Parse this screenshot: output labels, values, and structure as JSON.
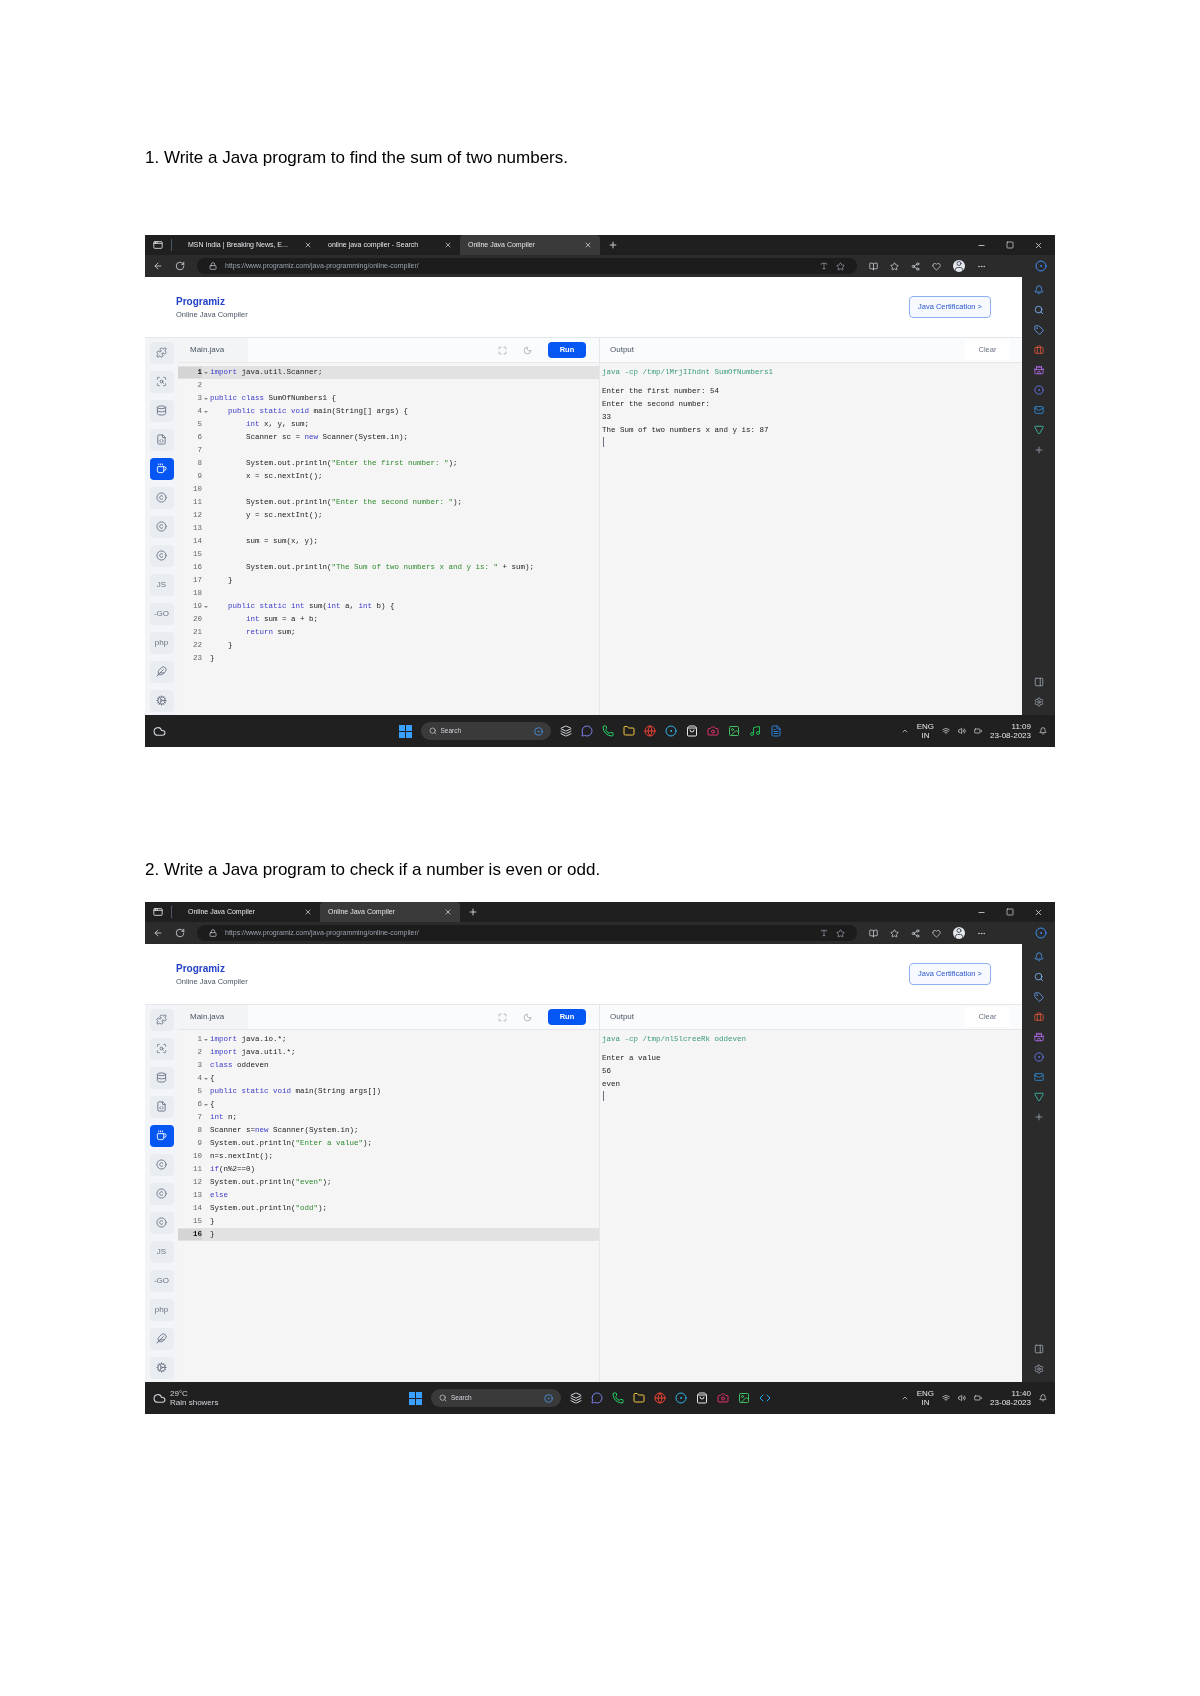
{
  "questions": [
    {
      "heading": "1. Write a Java program to find the sum of two numbers.",
      "screenshot": {
        "browser_tabs": [
          {
            "title": "MSN India | Breaking News, E...",
            "selected": false
          },
          {
            "title": "online java compiler - Search",
            "selected": false
          },
          {
            "title": "Online Java Compiler",
            "selected": true
          }
        ],
        "address": "https://www.programiz.com/java-programming/online-compiler/",
        "header": {
          "logo": "Programiz",
          "subtitle": "Online Java Compiler",
          "cta": "Java Certification >"
        },
        "language_rail": [
          {
            "kind": "icon",
            "selected": false
          },
          {
            "kind": "icon",
            "selected": false
          },
          {
            "kind": "icon",
            "selected": false
          },
          {
            "kind": "icon",
            "selected": false
          },
          {
            "kind": "icon",
            "selected": true
          },
          {
            "kind": "icon",
            "selected": false
          },
          {
            "kind": "icon",
            "selected": false
          },
          {
            "kind": "icon",
            "selected": false
          },
          {
            "kind": "text",
            "label": "JS",
            "selected": false
          },
          {
            "kind": "text",
            "label": "-GO",
            "selected": false
          },
          {
            "kind": "text",
            "label": "php",
            "selected": false
          },
          {
            "kind": "icon",
            "selected": false
          },
          {
            "kind": "icon",
            "selected": false
          }
        ],
        "editor": {
          "file_tab": "Main.java",
          "run": "Run",
          "lines": [
            {
              "num": "1",
              "fold": true,
              "selected": true,
              "segments": [
                {
                  "kind": "keyword",
                  "text": "import"
                },
                {
                  "kind": "plain",
                  "text": " java.util.Scanner;"
                }
              ]
            },
            {
              "num": "2",
              "fold": false,
              "selected": false
            },
            {
              "num": "3",
              "fold": true,
              "selected": false,
              "segments": [
                {
                  "kind": "keyword",
                  "text": "public class"
                },
                {
                  "kind": "plain",
                  "text": " SumOfNumbers1 {"
                }
              ]
            },
            {
              "num": "4",
              "fold": true,
              "selected": false,
              "segments": [
                {
                  "kind": "keyword",
                  "text": "    public static void"
                },
                {
                  "kind": "plain",
                  "text": " main(String[] args) {"
                }
              ]
            },
            {
              "num": "5",
              "fold": false,
              "selected": false,
              "segments": [
                {
                  "kind": "keyword",
                  "text": "        int"
                },
                {
                  "kind": "plain",
                  "text": " x, y, sum;"
                }
              ]
            },
            {
              "num": "6",
              "fold": false,
              "selected": false,
              "segments": [
                {
                  "kind": "plain",
                  "text": "        Scanner sc = "
                },
                {
                  "kind": "keyword",
                  "text": "new"
                },
                {
                  "kind": "plain",
                  "text": " Scanner(System.in);"
                }
              ]
            },
            {
              "num": "7",
              "fold": false,
              "selected": false
            },
            {
              "num": "8",
              "fold": false,
              "selected": false,
              "segments": [
                {
                  "kind": "plain",
                  "text": "        System.out.println("
                },
                {
                  "kind": "string",
                  "text": "\"Enter the first number: \""
                },
                {
                  "kind": "plain",
                  "text": ");"
                }
              ]
            },
            {
              "num": "9",
              "fold": false,
              "selected": false,
              "segments": [
                {
                  "kind": "plain",
                  "text": "        x = sc.nextInt();"
                }
              ]
            },
            {
              "num": "10",
              "fold": false,
              "selected": false
            },
            {
              "num": "11",
              "fold": false,
              "selected": false,
              "segments": [
                {
                  "kind": "plain",
                  "text": "        System.out.println("
                },
                {
                  "kind": "string",
                  "text": "\"Enter the second number: \""
                },
                {
                  "kind": "plain",
                  "text": ");"
                }
              ]
            },
            {
              "num": "12",
              "fold": false,
              "selected": false,
              "segments": [
                {
                  "kind": "plain",
                  "text": "        y = sc.nextInt();"
                }
              ]
            },
            {
              "num": "13",
              "fold": false,
              "selected": false
            },
            {
              "num": "14",
              "fold": false,
              "selected": false,
              "segments": [
                {
                  "kind": "plain",
                  "text": "        sum = sum(x, y);"
                }
              ]
            },
            {
              "num": "15",
              "fold": false,
              "selected": false
            },
            {
              "num": "16",
              "fold": false,
              "selected": false,
              "segments": [
                {
                  "kind": "plain",
                  "text": "        System.out.println("
                },
                {
                  "kind": "string",
                  "text": "\"The Sum of two numbers x and y is: \""
                },
                {
                  "kind": "plain",
                  "text": " + sum);"
                }
              ]
            },
            {
              "num": "17",
              "fold": false,
              "selected": false,
              "segments": [
                {
                  "kind": "plain",
                  "text": "    }"
                }
              ]
            },
            {
              "num": "18",
              "fold": false,
              "selected": false
            },
            {
              "num": "19",
              "fold": true,
              "selected": false,
              "segments": [
                {
                  "kind": "keyword",
                  "text": "    public static int"
                },
                {
                  "kind": "plain",
                  "text": " sum("
                },
                {
                  "kind": "keyword",
                  "text": "int"
                },
                {
                  "kind": "plain",
                  "text": " a, "
                },
                {
                  "kind": "keyword",
                  "text": "int"
                },
                {
                  "kind": "plain",
                  "text": " b) {"
                }
              ]
            },
            {
              "num": "20",
              "fold": false,
              "selected": false,
              "segments": [
                {
                  "kind": "keyword",
                  "text": "        int"
                },
                {
                  "kind": "plain",
                  "text": " sum = a + b;"
                }
              ]
            },
            {
              "num": "21",
              "fold": false,
              "selected": false,
              "segments": [
                {
                  "kind": "keyword",
                  "text": "        return"
                },
                {
                  "kind": "plain",
                  "text": " sum;"
                }
              ]
            },
            {
              "num": "22",
              "fold": false,
              "selected": false,
              "segments": [
                {
                  "kind": "plain",
                  "text": "    }"
                }
              ]
            },
            {
              "num": "23",
              "fold": false,
              "selected": false,
              "segments": [
                {
                  "kind": "plain",
                  "text": "}"
                }
              ]
            }
          ]
        },
        "output": {
          "title": "Output",
          "clear": "Clear",
          "lines": [
            {
              "kind": "command",
              "text": "java -cp /tmp/lMrjIIhdnt SumOfNumbers1"
            },
            {
              "kind": "text",
              "text": "Enter the first number: 54"
            },
            {
              "kind": "text",
              "text": "Enter the second number: "
            },
            {
              "kind": "text",
              "text": "33"
            },
            {
              "kind": "text",
              "text": "The Sum of two numbers x and y is: 87"
            }
          ]
        },
        "taskbar": {
          "search": "Search",
          "apps": [
            {
              "kind": "taskview"
            },
            {
              "kind": "chat"
            },
            {
              "kind": "whatsapp"
            },
            {
              "kind": "folder"
            },
            {
              "kind": "chrome"
            },
            {
              "kind": "edge"
            },
            {
              "kind": "store"
            },
            {
              "kind": "instagram"
            },
            {
              "kind": "photos"
            },
            {
              "kind": "spotify"
            },
            {
              "kind": "word"
            }
          ],
          "lang": "ENG",
          "region": "IN",
          "time": "11:09",
          "date": "23-08-2023"
        }
      }
    },
    {
      "heading": "2. Write a Java program to check if a number is even or odd.",
      "screenshot": {
        "browser_tabs": [
          {
            "title": "Online Java Compiler",
            "selected": false
          },
          {
            "title": "Online Java Compiler",
            "selected": true
          }
        ],
        "address": "https://www.programiz.com/java-programming/online-compiler/",
        "header": {
          "logo": "Programiz",
          "subtitle": "Online Java Compiler",
          "cta": "Java Certification >"
        },
        "language_rail": [
          {
            "kind": "icon",
            "selected": false
          },
          {
            "kind": "icon",
            "selected": false
          },
          {
            "kind": "icon",
            "selected": false
          },
          {
            "kind": "icon",
            "selected": false
          },
          {
            "kind": "icon",
            "selected": true
          },
          {
            "kind": "icon",
            "selected": false
          },
          {
            "kind": "icon",
            "selected": false
          },
          {
            "kind": "icon",
            "selected": false
          },
          {
            "kind": "text",
            "label": "JS",
            "selected": false
          },
          {
            "kind": "text",
            "label": "-GO",
            "selected": false
          },
          {
            "kind": "text",
            "label": "php",
            "selected": false
          },
          {
            "kind": "icon",
            "selected": false
          },
          {
            "kind": "icon",
            "selected": false
          }
        ],
        "editor": {
          "file_tab": "Main.java",
          "run": "Run",
          "lines": [
            {
              "num": "1",
              "fold": true,
              "selected": false,
              "segments": [
                {
                  "kind": "keyword",
                  "text": "import"
                },
                {
                  "kind": "plain",
                  "text": " java.io.*;"
                }
              ]
            },
            {
              "num": "2",
              "fold": false,
              "selected": false,
              "segments": [
                {
                  "kind": "keyword",
                  "text": "import"
                },
                {
                  "kind": "plain",
                  "text": " java.util.*;"
                }
              ]
            },
            {
              "num": "3",
              "fold": false,
              "selected": false,
              "segments": [
                {
                  "kind": "keyword",
                  "text": "class"
                },
                {
                  "kind": "plain",
                  "text": " oddeven"
                }
              ]
            },
            {
              "num": "4",
              "fold": true,
              "selected": false,
              "segments": [
                {
                  "kind": "plain",
                  "text": "{"
                }
              ]
            },
            {
              "num": "5",
              "fold": false,
              "selected": false,
              "segments": [
                {
                  "kind": "keyword",
                  "text": "public static void"
                },
                {
                  "kind": "plain",
                  "text": " main(String args[])"
                }
              ]
            },
            {
              "num": "6",
              "fold": true,
              "selected": false,
              "segments": [
                {
                  "kind": "plain",
                  "text": "{"
                }
              ]
            },
            {
              "num": "7",
              "fold": false,
              "selected": false,
              "segments": [
                {
                  "kind": "keyword",
                  "text": "int"
                },
                {
                  "kind": "plain",
                  "text": " n;"
                }
              ]
            },
            {
              "num": "8",
              "fold": false,
              "selected": false,
              "segments": [
                {
                  "kind": "plain",
                  "text": "Scanner s="
                },
                {
                  "kind": "keyword",
                  "text": "new"
                },
                {
                  "kind": "plain",
                  "text": " Scanner(System.in);"
                }
              ]
            },
            {
              "num": "9",
              "fold": false,
              "selected": false,
              "segments": [
                {
                  "kind": "plain",
                  "text": "System.out.println("
                },
                {
                  "kind": "string",
                  "text": "\"Enter a value\""
                },
                {
                  "kind": "plain",
                  "text": ");"
                }
              ]
            },
            {
              "num": "10",
              "fold": false,
              "selected": false,
              "segments": [
                {
                  "kind": "plain",
                  "text": "n=s.nextInt();"
                }
              ]
            },
            {
              "num": "11",
              "fold": false,
              "selected": false,
              "segments": [
                {
                  "kind": "keyword",
                  "text": "if"
                },
                {
                  "kind": "plain",
                  "text": "(n%2==0)"
                }
              ]
            },
            {
              "num": "12",
              "fold": false,
              "selected": false,
              "segments": [
                {
                  "kind": "plain",
                  "text": "System.out.println("
                },
                {
                  "kind": "string",
                  "text": "\"even\""
                },
                {
                  "kind": "plain",
                  "text": ");"
                }
              ]
            },
            {
              "num": "13",
              "fold": false,
              "selected": false,
              "segments": [
                {
                  "kind": "keyword",
                  "text": "else"
                }
              ]
            },
            {
              "num": "14",
              "fold": false,
              "selected": false,
              "segments": [
                {
                  "kind": "plain",
                  "text": "System.out.println("
                },
                {
                  "kind": "string",
                  "text": "\"odd\""
                },
                {
                  "kind": "plain",
                  "text": ");"
                }
              ]
            },
            {
              "num": "15",
              "fold": false,
              "selected": false,
              "segments": [
                {
                  "kind": "plain",
                  "text": "}"
                }
              ]
            },
            {
              "num": "16",
              "fold": false,
              "selected": true,
              "segments": [
                {
                  "kind": "plain",
                  "text": "}"
                }
              ]
            }
          ]
        },
        "output": {
          "title": "Output",
          "clear": "Clear",
          "lines": [
            {
              "kind": "command",
              "text": "java -cp /tmp/nl5lcreeRk oddeven"
            },
            {
              "kind": "text",
              "text": "Enter a value"
            },
            {
              "kind": "text",
              "text": "56"
            },
            {
              "kind": "text",
              "text": "even"
            }
          ]
        },
        "taskbar": {
          "weather": {
            "temp": "29°C",
            "condition": "Rain showers"
          },
          "search": "Search",
          "apps": [
            {
              "kind": "taskview"
            },
            {
              "kind": "chat"
            },
            {
              "kind": "whatsapp"
            },
            {
              "kind": "folder"
            },
            {
              "kind": "chrome"
            },
            {
              "kind": "edge"
            },
            {
              "kind": "store"
            },
            {
              "kind": "instagram"
            },
            {
              "kind": "photos"
            },
            {
              "kind": "vscode"
            }
          ],
          "lang": "ENG",
          "region": "IN",
          "time": "11:40",
          "date": "23-08-2023"
        }
      }
    }
  ]
}
